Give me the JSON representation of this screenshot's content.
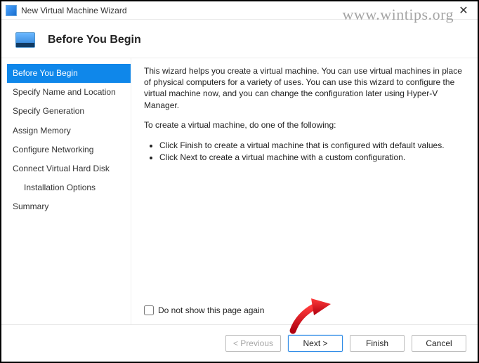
{
  "titlebar": {
    "title": "New Virtual Machine Wizard"
  },
  "header": {
    "title": "Before You Begin"
  },
  "sidebar": {
    "items": [
      {
        "label": "Before You Begin",
        "selected": true
      },
      {
        "label": "Specify Name and Location"
      },
      {
        "label": "Specify Generation"
      },
      {
        "label": "Assign Memory"
      },
      {
        "label": "Configure Networking"
      },
      {
        "label": "Connect Virtual Hard Disk"
      },
      {
        "label": "Installation Options",
        "indent": true
      },
      {
        "label": "Summary"
      }
    ]
  },
  "content": {
    "p1": "This wizard helps you create a virtual machine. You can use virtual machines in place of physical computers for a variety of uses. You can use this wizard to configure the virtual machine now, and you can change the configuration later using Hyper-V Manager.",
    "p2": "To create a virtual machine, do one of the following:",
    "bullets": [
      "Click Finish to create a virtual machine that is configured with default values.",
      "Click Next to create a virtual machine with a custom configuration."
    ],
    "checkbox_label": "Do not show this page again"
  },
  "footer": {
    "previous": "< Previous",
    "next": "Next >",
    "finish": "Finish",
    "cancel": "Cancel"
  },
  "watermark": "www.wintips.org"
}
